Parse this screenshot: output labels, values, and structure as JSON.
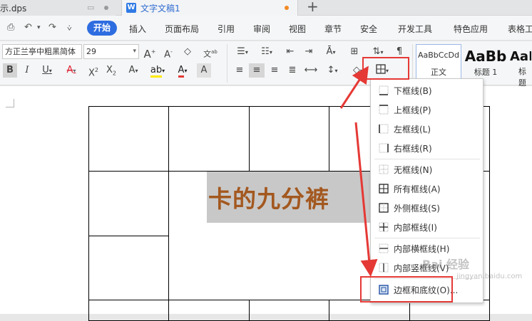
{
  "tabs": {
    "tab1_title": "示.dps",
    "tab2_title": "文字文稿1",
    "tab2_icon": "W",
    "new_tab": "+"
  },
  "menu": {
    "items": [
      "开始",
      "插入",
      "页面布局",
      "引用",
      "审阅",
      "视图",
      "章节",
      "安全",
      "开发工具",
      "特色应用",
      "表格工"
    ]
  },
  "ribbon": {
    "font_name": "方正兰亭中粗黑简体",
    "font_size": "29",
    "style_sample_1": "AaBbCcDd",
    "style_name_1": "正文",
    "style_sample_2": "AaBb",
    "style_name_2": "标题 1",
    "style_sample_3": "AaI",
    "style_name_3": "标题"
  },
  "document": {
    "cell_text": "卡的九分裤"
  },
  "border_menu": {
    "items": [
      {
        "label": "下框线(B)",
        "icon": "border-bottom-icon"
      },
      {
        "label": "上框线(P)",
        "icon": "border-top-icon"
      },
      {
        "label": "左框线(L)",
        "icon": "border-left-icon"
      },
      {
        "label": "右框线(R)",
        "icon": "border-right-icon"
      },
      {
        "label": "无框线(N)",
        "icon": "border-none-icon"
      },
      {
        "label": "所有框线(A)",
        "icon": "border-all-icon"
      },
      {
        "label": "外侧框线(S)",
        "icon": "border-outside-icon"
      },
      {
        "label": "内部框线(I)",
        "icon": "border-inside-icon"
      },
      {
        "label": "内部横框线(H)",
        "icon": "border-inside-horizontal-icon"
      },
      {
        "label": "内部竖框线(V)",
        "icon": "border-inside-vertical-icon"
      },
      {
        "label": "边框和底纹(O)...",
        "icon": "borders-and-shading-icon"
      }
    ]
  },
  "watermark": {
    "text": "Bai 经验",
    "url": "jingyan.baidu.com"
  },
  "colors": {
    "accent": "#2e6de0",
    "highlight_red": "#e53935",
    "text_brown": "#a3581f",
    "selection_gray": "#c8c8c8"
  }
}
